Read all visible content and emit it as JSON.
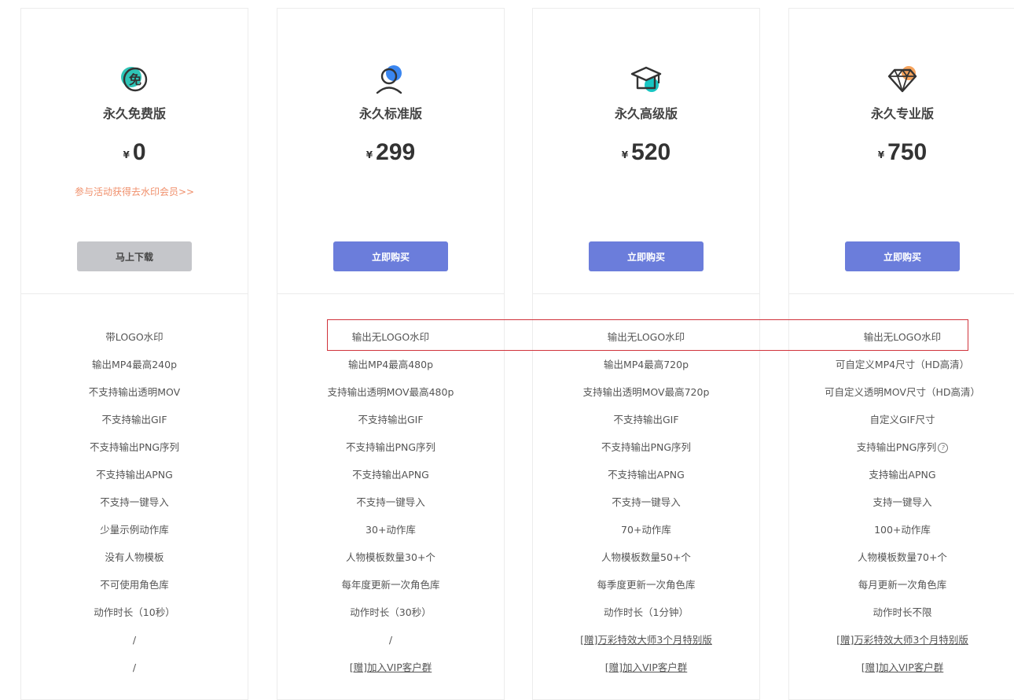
{
  "colors": {
    "accent": "#6b7ddb",
    "promo": "#f0906c",
    "grey_button": "#c5c6ca",
    "highlight": "#d0333b"
  },
  "plans": [
    {
      "icon": "free-badge-icon",
      "icon_char": "免",
      "name": "永久免费版",
      "currency": "¥",
      "price": "0",
      "promo": "参与活动获得去水印会员>>",
      "button": "马上下载",
      "features": [
        "带LOGO水印",
        "输出MP4最高240p",
        "不支持输出透明MOV",
        "不支持输出GIF",
        "不支持输出PNG序列",
        "不支持输出APNG",
        "不支持一键导入",
        "少量示例动作库",
        "没有人物模板",
        "不可使用角色库",
        "动作时长（10秒）",
        "/",
        "/"
      ]
    },
    {
      "icon": "user-icon",
      "name": "永久标准版",
      "currency": "¥",
      "price": "299",
      "button": "立即购买",
      "features": [
        "输出无LOGO水印",
        "输出MP4最高480p",
        "支持输出透明MOV最高480p",
        "不支持输出GIF",
        "不支持输出PNG序列",
        "不支持输出APNG",
        "不支持一键导入",
        "30+动作库",
        "人物模板数量30+个",
        "每年度更新一次角色库",
        "动作时长（30秒）",
        "/",
        "[赠]加入VIP客户群"
      ]
    },
    {
      "icon": "graduation-cap-icon",
      "name": "永久高级版",
      "currency": "¥",
      "price": "520",
      "button": "立即购买",
      "features": [
        "输出无LOGO水印",
        "输出MP4最高720p",
        "支持输出透明MOV最高720p",
        "不支持输出GIF",
        "不支持输出PNG序列",
        "不支持输出APNG",
        "不支持一键导入",
        "70+动作库",
        "人物模板数量50+个",
        "每季度更新一次角色库",
        "动作时长（1分钟）",
        "[赠]万彩特效大师3个月特别版",
        "[赠]加入VIP客户群"
      ]
    },
    {
      "icon": "diamond-icon",
      "name": "永久专业版",
      "currency": "¥",
      "price": "750",
      "button": "立即购买",
      "features": [
        "输出无LOGO水印",
        "可自定义MP4尺寸（HD高清）",
        "可自定义透明MOV尺寸（HD高清）",
        "自定义GIF尺寸",
        "支持输出PNG序列",
        "支持输出APNG",
        "支持一键导入",
        "100+动作库",
        "人物模板数量70+个",
        "每月更新一次角色库",
        "动作时长不限",
        "[赠]万彩特效大师3个月特别版",
        "[赠]加入VIP客户群"
      ],
      "help_icon": "?"
    }
  ]
}
